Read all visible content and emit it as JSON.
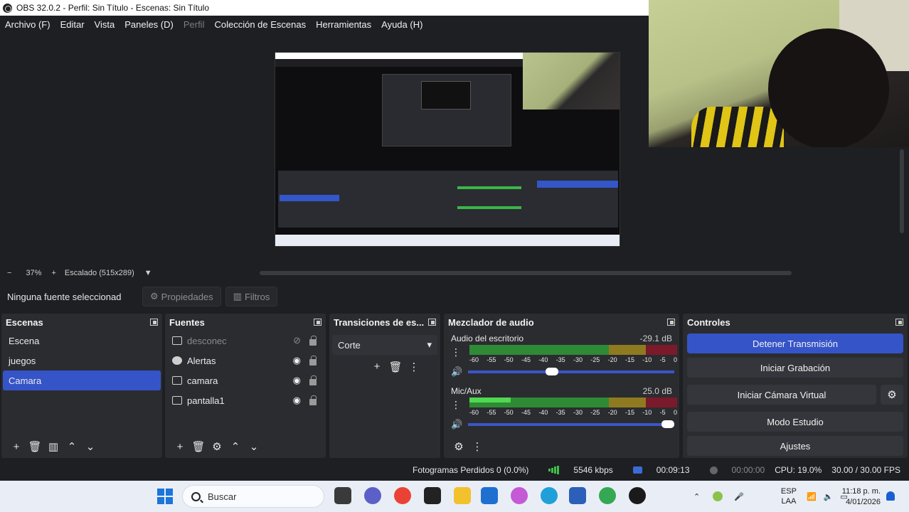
{
  "window": {
    "title": "OBS 32.0.2 - Perfil: Sin Título - Escenas: Sin Título"
  },
  "menu": [
    {
      "label": "Archivo (F)",
      "enabled": true
    },
    {
      "label": "Editar",
      "enabled": true
    },
    {
      "label": "Vista",
      "enabled": true
    },
    {
      "label": "Paneles (D)",
      "enabled": true
    },
    {
      "label": "Perfil",
      "enabled": false
    },
    {
      "label": "Colección de Escenas",
      "enabled": true
    },
    {
      "label": "Herramientas",
      "enabled": true
    },
    {
      "label": "Ayuda (H)",
      "enabled": true
    }
  ],
  "zoom": {
    "minus": "−",
    "level": "37%",
    "plus": "+",
    "scaling": "Escalado (515x289)"
  },
  "context": {
    "no_source": "Ninguna fuente seleccionad",
    "properties": "Propiedades",
    "filters": "Filtros"
  },
  "scenes": {
    "title": "Escenas",
    "items": [
      "Escena",
      "juegos",
      "Camara"
    ],
    "selected_index": 2
  },
  "sources": {
    "title": "Fuentes",
    "items": [
      {
        "name": "desconec",
        "icon": "image-icon",
        "visible": false
      },
      {
        "name": "Alertas",
        "icon": "browser-icon",
        "visible": true
      },
      {
        "name": "camara",
        "icon": "camera-icon",
        "visible": true
      },
      {
        "name": "pantalla1",
        "icon": "display-icon",
        "visible": true
      }
    ]
  },
  "transitions": {
    "title": "Transiciones de es...",
    "selected": "Corte"
  },
  "mixer": {
    "title": "Mezclador de audio",
    "channels": [
      {
        "name": "Audio del escritorio",
        "db": "-29.1 dB",
        "level": 0.0,
        "volume": 0.4
      },
      {
        "name": "Mic/Aux",
        "db": "25.0 dB",
        "level": 0.2,
        "volume": 1.0
      }
    ],
    "scale": [
      "-60",
      "-55",
      "-50",
      "-45",
      "-40",
      "-35",
      "-30",
      "-25",
      "-20",
      "-15",
      "-10",
      "-5",
      "0"
    ]
  },
  "controls": {
    "title": "Controles",
    "stop_stream": "Detener Transmisión",
    "start_recording": "Iniciar Grabación",
    "start_virtual_cam": "Iniciar Cámara Virtual",
    "studio_mode": "Modo Estudio",
    "settings": "Ajustes"
  },
  "status": {
    "dropped_frames": "Fotogramas Perdidos 0 (0.0%)",
    "bitrate": "5546 kbps",
    "stream_time": "00:09:13",
    "record_time": "00:00:00",
    "cpu": "CPU: 19.0%",
    "fps": "30.00 / 30.00 FPS"
  },
  "taskbar": {
    "search_placeholder": "Buscar",
    "lang_top": "ESP",
    "lang_bottom": "LAA",
    "time": "11:18 p. m.",
    "date": "4/01/2026"
  },
  "colors": {
    "accent": "#3554c8",
    "panel": "#2b2c30",
    "background": "#1e1f22"
  }
}
